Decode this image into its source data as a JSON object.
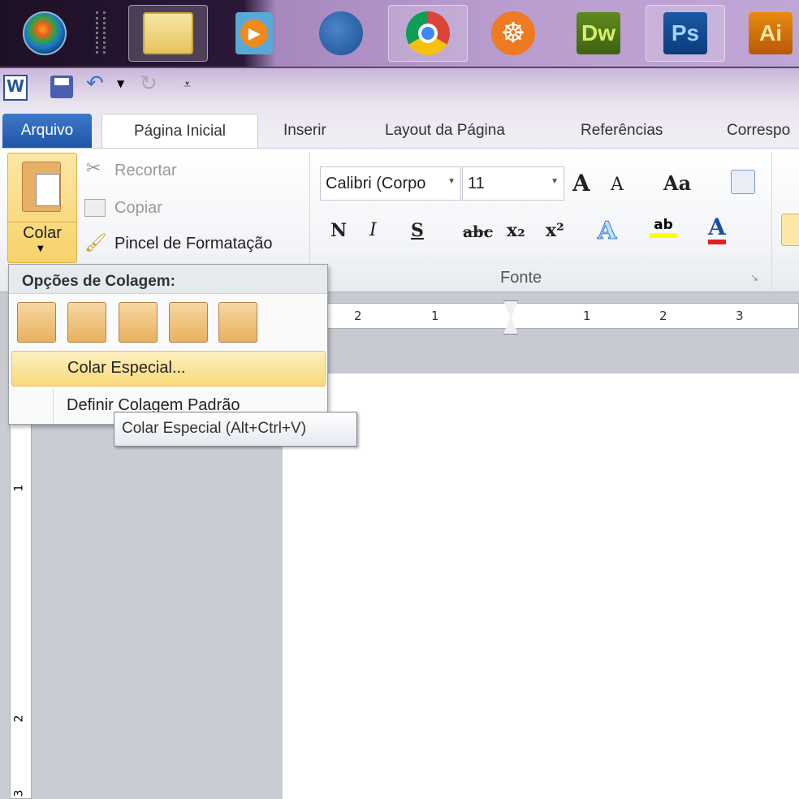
{
  "taskbar": {
    "items": [
      {
        "name": "start-button",
        "label": ""
      },
      {
        "name": "file-explorer",
        "label": ""
      },
      {
        "name": "media-player",
        "label": ""
      },
      {
        "name": "firefox",
        "label": ""
      },
      {
        "name": "chrome",
        "label": ""
      },
      {
        "name": "helm-app",
        "label": ""
      },
      {
        "name": "dreamweaver",
        "label": "Dw"
      },
      {
        "name": "photoshop",
        "label": "Ps"
      },
      {
        "name": "illustrator",
        "label": "Ai"
      }
    ]
  },
  "qat": {
    "app_logo": "W"
  },
  "tabs": {
    "file": "Arquivo",
    "items": [
      "Página Inicial",
      "Inserir",
      "Layout da Página",
      "Referências",
      "Correspo"
    ],
    "active": "Página Inicial"
  },
  "clipboard": {
    "paste": "Colar",
    "cut": "Recortar",
    "copy": "Copiar",
    "format_painter": "Pincel de Formatação"
  },
  "font": {
    "name": "Calibri (Corpo",
    "size": "11",
    "group_label": "Fonte",
    "bold": "N",
    "italic": "I",
    "underline": "S",
    "strike": "abc",
    "subscript": "x₂",
    "superscript": "x²",
    "grow": "A",
    "shrink": "A",
    "case": "Aa",
    "highlight": "ab",
    "color": "A",
    "highlight_color": "#ffff00",
    "font_color": "#e02020"
  },
  "ruler": {
    "labels": [
      "2",
      "1",
      "1",
      "2",
      "3"
    ],
    "vlabels": [
      "1",
      "2",
      "3"
    ]
  },
  "paste_menu": {
    "header": "Opções de Colagem:",
    "special": "Colar Especial...",
    "set_default": "Definir Colagem Padrão"
  },
  "tooltip": {
    "text": "Colar Especial (Alt+Ctrl+V)"
  }
}
